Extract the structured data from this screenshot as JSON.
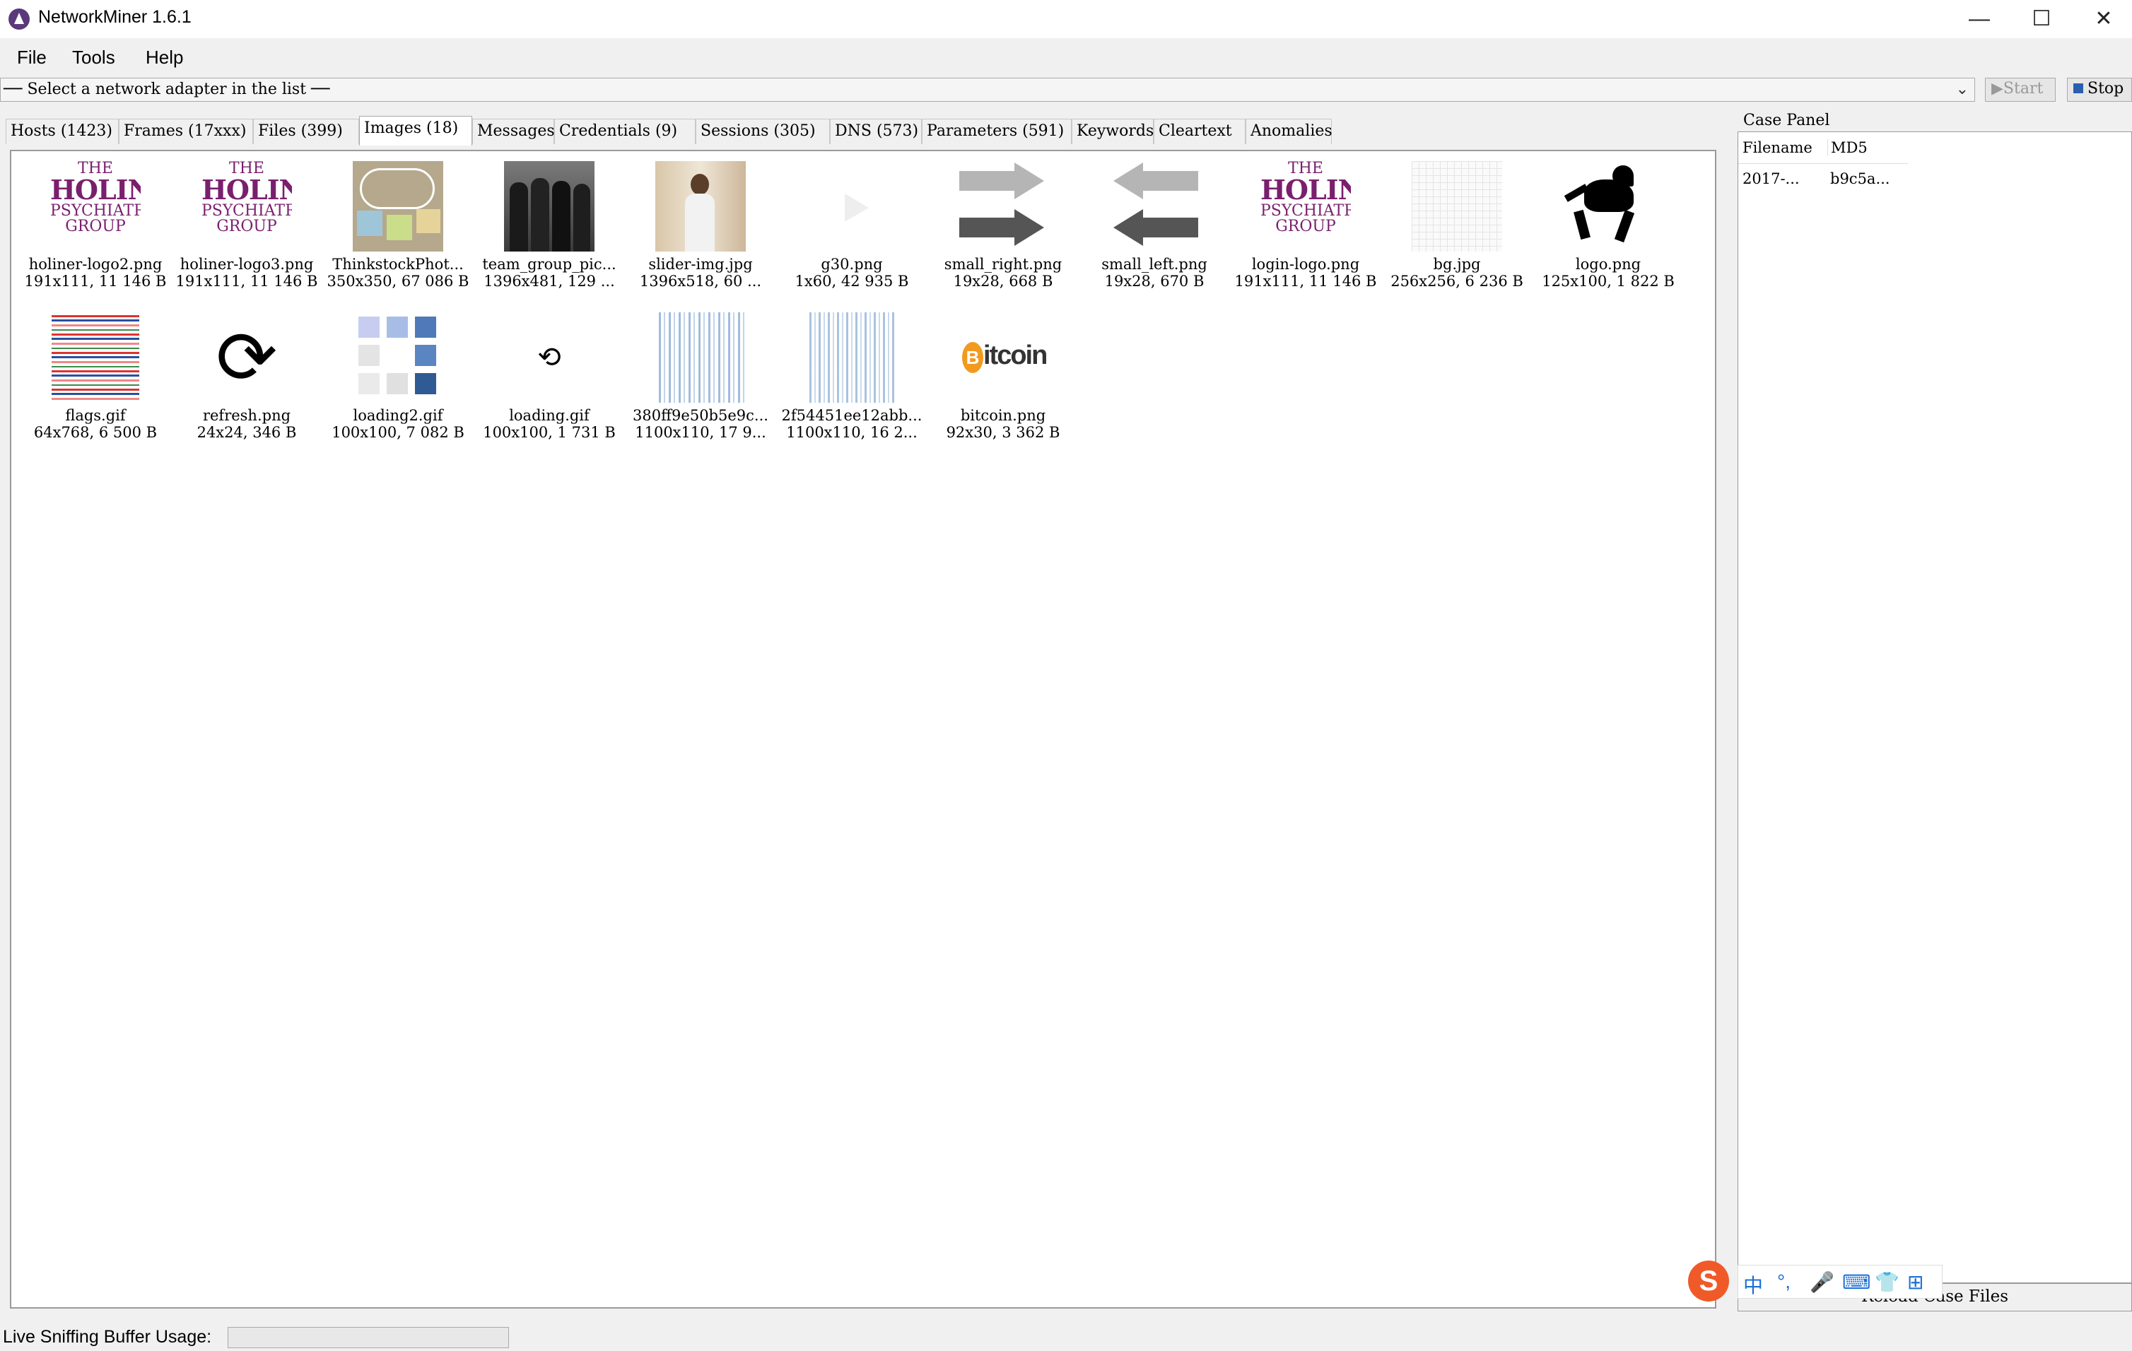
{
  "window": {
    "title": "NetworkMiner 1.6.1",
    "min_glyph": "—",
    "max_glyph": "☐",
    "close_glyph": "✕"
  },
  "menu": [
    "File",
    "Tools",
    "Help"
  ],
  "adapter": {
    "placeholder": "── Select a network adapter in the list ──",
    "arrow": "⌄",
    "start_label": "▶Start",
    "stop_label": "Stop"
  },
  "tabs": [
    "Hosts (1423)",
    "Frames (17xxx)",
    "Files (399)",
    "Images (18)",
    "Messages",
    "Credentials (9)",
    "Sessions (305)",
    "DNS (573)",
    "Parameters (591)",
    "Keywords",
    "Cleartext",
    "Anomalies"
  ],
  "active_tab": "Images (18)",
  "logo_text": {
    "the": "THE",
    "name": "HOLINER",
    "line1": "PSYCHIATRIC",
    "line2": "GROUP"
  },
  "images": [
    {
      "name": "holiner-logo2.png",
      "meta": "191x111, 11 146 B",
      "icon": "holiner-logo"
    },
    {
      "name": "holiner-logo3.png",
      "meta": "191x111, 11 146 B",
      "icon": "holiner-logo"
    },
    {
      "name": "ThinkstockPhot...",
      "meta": "350x350, 67 086 B",
      "icon": "sticky-notes"
    },
    {
      "name": "team_group_pic...",
      "meta": "1396x481, 129 ...",
      "icon": "group-photo"
    },
    {
      "name": "slider-img.jpg",
      "meta": "1396x518, 60 ...",
      "icon": "person-photo"
    },
    {
      "name": "g30.png",
      "meta": "1x60, 42 935 B",
      "icon": "play-arrow"
    },
    {
      "name": "small_right.png",
      "meta": "19x28, 668 B",
      "icon": "right-arrows"
    },
    {
      "name": "small_left.png",
      "meta": "19x28, 670 B",
      "icon": "left-arrows"
    },
    {
      "name": "login-logo.png",
      "meta": "191x111, 11 146 B",
      "icon": "holiner-logo"
    },
    {
      "name": "bg.jpg",
      "meta": "256x256, 6 236 B",
      "icon": "grid-background"
    },
    {
      "name": "logo.png",
      "meta": "125x100, 1 822 B",
      "icon": "griffin-logo"
    },
    {
      "name": "flags.gif",
      "meta": "64x768, 6 500 B",
      "icon": "flags-strip"
    },
    {
      "name": "refresh.png",
      "meta": "24x24, 346 B",
      "icon": "refresh"
    },
    {
      "name": "loading2.gif",
      "meta": "100x100, 7 082 B",
      "icon": "loading-squares"
    },
    {
      "name": "loading.gif",
      "meta": "100x100, 1 731 B",
      "icon": "loading-spinner"
    },
    {
      "name": "380ff9e50b5e9c...",
      "meta": "1100x110, 17 9...",
      "icon": "blue-pattern"
    },
    {
      "name": "2f54451ee12abb...",
      "meta": "1100x110, 16 2...",
      "icon": "blue-pattern"
    },
    {
      "name": "bitcoin.png",
      "meta": "92x30, 3 362 B",
      "icon": "bitcoin-logo"
    }
  ],
  "case_panel": {
    "label": "Case Panel",
    "col_filename": "Filename",
    "col_md5": "MD5",
    "row_filename": "2017-...",
    "row_md5": "b9c5a...",
    "reload_label": "Reload Case Files"
  },
  "status": {
    "buffer_label": "Live Sniffing Buffer Usage:"
  },
  "ime": {
    "logo": "S",
    "items": [
      "中",
      "°,",
      "🎤",
      "⌨",
      "👕",
      "⊞"
    ]
  }
}
